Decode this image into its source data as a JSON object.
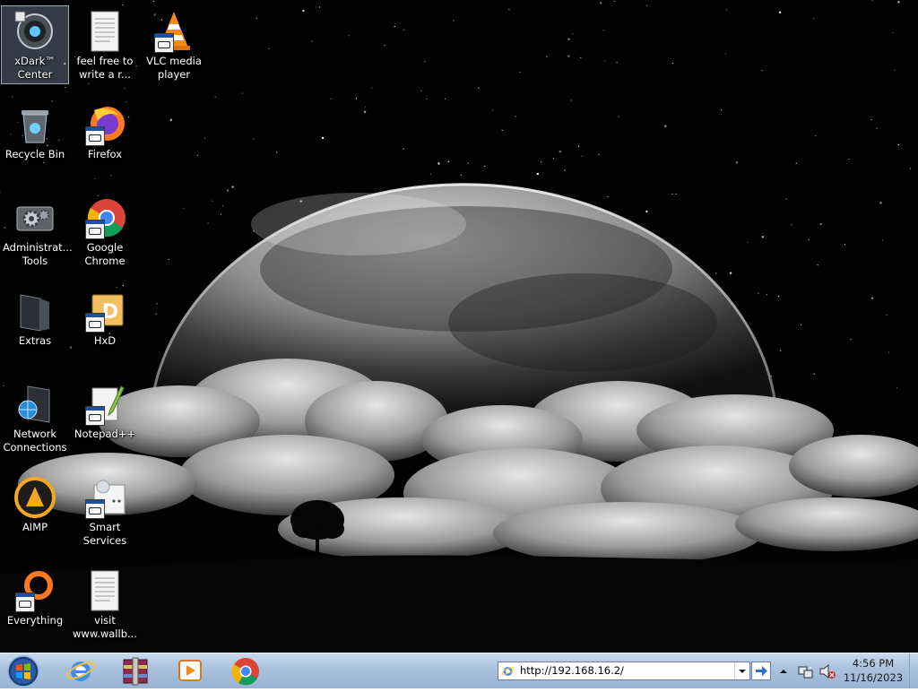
{
  "desktop": {
    "icons": [
      {
        "name": "xdark-center",
        "label": "xDark™ Center",
        "icon": "xdark-center-icon"
      },
      {
        "name": "feel-free-text",
        "label": "feel free to write a r...",
        "icon": "text-document-icon"
      },
      {
        "name": "vlc",
        "label": "VLC media player",
        "icon": "vlc-cone-icon"
      },
      {
        "name": "recycle-bin",
        "label": "Recycle Bin",
        "icon": "recycle-bin-icon"
      },
      {
        "name": "firefox",
        "label": "Firefox",
        "icon": "firefox-icon"
      },
      {
        "name": "administrative-tools",
        "label": "Administrat... Tools",
        "icon": "gears-icon"
      },
      {
        "name": "google-chrome",
        "label": "Google Chrome",
        "icon": "chrome-icon"
      },
      {
        "name": "extras",
        "label": "Extras",
        "icon": "folder-icon"
      },
      {
        "name": "hxd",
        "label": "HxD",
        "icon": "hxd-icon"
      },
      {
        "name": "network-connections",
        "label": "Network Connections",
        "icon": "network-globe-icon"
      },
      {
        "name": "notepad-plus-plus",
        "label": "Notepad++",
        "icon": "notepad-icon"
      },
      {
        "name": "aimp",
        "label": "AIMP",
        "icon": "aimp-icon"
      },
      {
        "name": "smart-services",
        "label": "Smart Services",
        "icon": "smart-services-icon"
      },
      {
        "name": "everything",
        "label": "Everything",
        "icon": "everything-search-icon"
      },
      {
        "name": "visit-wallpaper",
        "label": "visit www.wallb...",
        "icon": "text-document-icon"
      }
    ]
  },
  "taskbar": {
    "start": "start-orb-icon",
    "pinned": [
      {
        "name": "internet-explorer",
        "icon": "internet-explorer-icon"
      },
      {
        "name": "winrar",
        "icon": "winrar-books-icon"
      },
      {
        "name": "media-player",
        "icon": "media-play-icon"
      },
      {
        "name": "chrome",
        "icon": "chrome-icon"
      }
    ],
    "address": {
      "value": "http://192.168.16.2/"
    },
    "clock": {
      "time": "4:56 PM",
      "date": "11/16/2023"
    }
  },
  "colors": {
    "taskbar": "#a9c1dd",
    "selection": "#96aac8",
    "sky": "#020203"
  }
}
